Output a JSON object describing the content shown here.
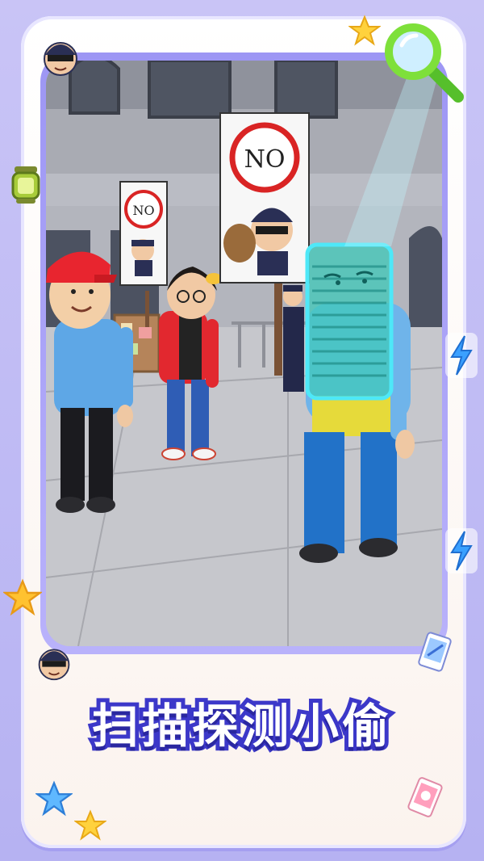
{
  "banner": {
    "title": "扫描探测小偷"
  },
  "scene": {
    "sign_left": "NO",
    "sign_right": "NO"
  },
  "colors": {
    "background": "#c5c0f5",
    "frame": "#ffffff",
    "title_fill": "#ffffff",
    "title_outline": "#3c38c9",
    "scan_box": "#35d3e8",
    "magnifier": "#7ee03a"
  },
  "icons": [
    "thief-face-icon",
    "magnifier-icon",
    "star-icon",
    "lantern-icon",
    "lightning-icon",
    "card-icon",
    "star-icon",
    "thief-face-icon"
  ]
}
